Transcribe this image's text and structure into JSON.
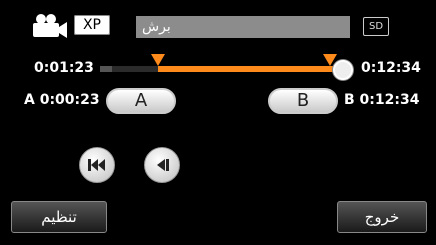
{
  "header": {
    "camera_icon": "video-camera-icon",
    "quality": "XP",
    "title": "برش",
    "media": "SD"
  },
  "timeline": {
    "current_time": "0:01:23",
    "end_time": "0:12:34",
    "accent_color": "#ff8a1c"
  },
  "points": {
    "a_label": "A",
    "a_time": "0:00:23",
    "b_label": "B",
    "b_time": "0:12:34"
  },
  "buttons": {
    "set_a": "A",
    "set_b": "B",
    "skip_back_icon": "skip-back-icon",
    "frame_back_icon": "frame-back-icon",
    "settings": "تنظیم",
    "exit": "خروج"
  }
}
